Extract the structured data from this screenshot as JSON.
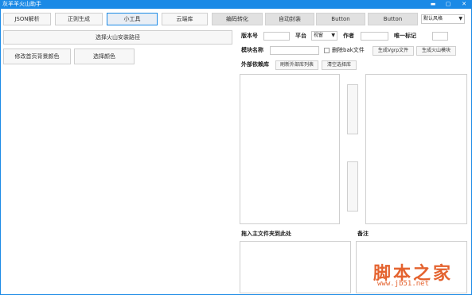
{
  "window": {
    "title": "灰羊羊火山助手",
    "controls": {
      "minimize": "▬",
      "maximize": "▢",
      "close": "✕"
    }
  },
  "toolbar": {
    "tabs": [
      {
        "label": "JSON解析",
        "state": "normal"
      },
      {
        "label": "正则生成",
        "state": "normal"
      },
      {
        "label": "小工具",
        "state": "active"
      },
      {
        "label": "云端库",
        "state": "normal"
      },
      {
        "label": "编码转化",
        "state": "disabled"
      },
      {
        "label": "自动封装",
        "state": "disabled"
      },
      {
        "label": "Button",
        "state": "disabled"
      },
      {
        "label": "Button",
        "state": "disabled"
      }
    ],
    "style_select": {
      "value": "默认风格"
    }
  },
  "left": {
    "choose_path_label": "选择火山安装路径",
    "modify_bg_label": "修改首页背景颜色",
    "choose_color_label": "选择颜色"
  },
  "form": {
    "version_label": "版本号",
    "version_value": "",
    "platform_label": "平台",
    "platform_value": "视窗",
    "author_label": "作者",
    "author_value": "",
    "uid_label": "唯一标记",
    "uid_value": "",
    "module_name_label": "模块名称",
    "module_name_value": "",
    "delete_bak_label": "删除bak文件",
    "gen_vgrp_label": "生成Vgrp文件",
    "gen_module_label": "生成火山模块",
    "ext_lib_label": "外部依赖库",
    "refresh_ext_label": "刷新外部库列表",
    "clear_sel_label": "清空选择库",
    "drag_label": "拖入主文件夹到此处",
    "note_label": "备注"
  },
  "watermark": {
    "main": "脚本之家",
    "sub": "www.jb51.net"
  },
  "colors": {
    "accent": "#1b8ae6",
    "watermark": "#e4632f"
  }
}
